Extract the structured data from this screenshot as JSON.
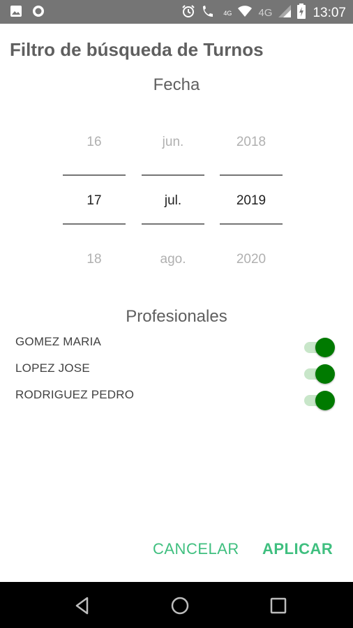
{
  "status_bar": {
    "time": "13:07",
    "network_label": "4G",
    "network_label_small": "4G",
    "icons": [
      "image-icon",
      "circle-icon",
      "alarm-icon",
      "wifi-call-icon",
      "wifi-icon",
      "signal-icon",
      "battery-icon"
    ]
  },
  "dialog": {
    "title": "Filtro de búsqueda de Turnos",
    "date_section_title": "Fecha",
    "date_picker": {
      "day": {
        "prev": "16",
        "selected": "17",
        "next": "18"
      },
      "month": {
        "prev": "jun.",
        "selected": "jul.",
        "next": "ago."
      },
      "year": {
        "prev": "2018",
        "selected": "2019",
        "next": "2020"
      }
    },
    "professionals_section_title": "Profesionales",
    "professionals": [
      {
        "name": "GOMEZ MARIA",
        "enabled": true
      },
      {
        "name": "LOPEZ JOSE",
        "enabled": true
      },
      {
        "name": "RODRIGUEZ PEDRO",
        "enabled": true
      }
    ],
    "cancel_label": "CANCELAR",
    "apply_label": "APLICAR"
  },
  "nav_bar": {
    "icons": [
      "back-icon",
      "home-icon",
      "recents-icon"
    ]
  },
  "colors": {
    "accent": "#3fbf7f",
    "toggle_on": "#007a00",
    "toggle_track": "#c8e6c9",
    "status_bar": "#757575"
  }
}
